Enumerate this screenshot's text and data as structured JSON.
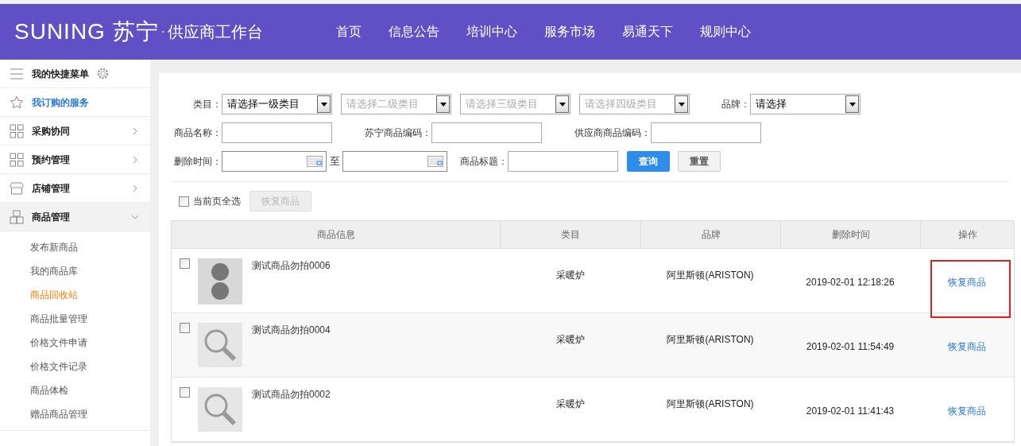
{
  "header": {
    "logo": "SUNING 苏宁",
    "separator": "·",
    "subtitle": "供应商工作台",
    "nav": [
      "首页",
      "信息公告",
      "培训中心",
      "服务市场",
      "易通天下",
      "规则中心"
    ]
  },
  "sidebar": {
    "items": [
      {
        "label": "我的快捷菜单",
        "kind": "menu",
        "selected": false
      },
      {
        "label": "我订购的服务",
        "kind": "star",
        "selected": true
      },
      {
        "label": "采购协同",
        "kind": "grid",
        "selected": false,
        "expanded": false
      },
      {
        "label": "预约管理",
        "kind": "grid",
        "selected": false,
        "expanded": false
      },
      {
        "label": "店铺管理",
        "kind": "store",
        "selected": false,
        "expanded": false
      },
      {
        "label": "商品管理",
        "kind": "boxes",
        "selected": false,
        "expanded": true,
        "children": [
          {
            "label": "发布新商品",
            "selected": false
          },
          {
            "label": "我的商品库",
            "selected": false
          },
          {
            "label": "商品回收站",
            "selected": true
          },
          {
            "label": "商品批量管理",
            "selected": false
          },
          {
            "label": "价格文件申请",
            "selected": false
          },
          {
            "label": "价格文件记录",
            "selected": false
          },
          {
            "label": "商品体检",
            "selected": false
          },
          {
            "label": "赠品商品管理",
            "selected": false
          }
        ]
      }
    ]
  },
  "filters": {
    "category_label": "类目：",
    "category_selects": [
      {
        "value": "请选择一级类目"
      },
      {
        "placeholder": "请选择二级类目"
      },
      {
        "placeholder": "请选择三级类目"
      },
      {
        "placeholder": "请选择四级类目"
      }
    ],
    "brand_label": "品牌：",
    "brand_select": {
      "value": "请选择"
    },
    "name_label": "商品名称：",
    "suning_code_label": "苏宁商品编码：",
    "supplier_code_label": "供应商商品编码：",
    "delete_time_label": "删除时间：",
    "to_label": "至",
    "title_label": "商品标题：",
    "query_button": "查询",
    "reset_button": "重置"
  },
  "bulk": {
    "select_all": {
      "label": "当前页全选",
      "checked": false
    },
    "restore_button": {
      "label": "恢复商品",
      "disabled": true
    }
  },
  "table": {
    "columns": [
      "商品信息",
      "类目",
      "品牌",
      "删除时间",
      "操作"
    ],
    "rows": [
      {
        "checked": false,
        "kind": "photo",
        "name": "测试商品勿拍0006",
        "category": "采暖炉",
        "brand": "阿里斯顿(ARISTON)",
        "deleted_at": "2019-02-01 12:18:26",
        "action": "恢复商品",
        "highlighted": true
      },
      {
        "checked": false,
        "kind": "no-image",
        "name": "测试商品勿拍0004",
        "category": "采暖炉",
        "brand": "阿里斯顿(ARISTON)",
        "deleted_at": "2019-02-01 11:54:49",
        "action": "恢复商品",
        "highlighted": false
      },
      {
        "checked": false,
        "kind": "no-image",
        "name": "测试商品勿拍0002",
        "category": "采暖炉",
        "brand": "阿里斯顿(ARISTON)",
        "deleted_at": "2019-02-01 11:41:43",
        "action": "恢复商品",
        "highlighted": false
      }
    ]
  }
}
